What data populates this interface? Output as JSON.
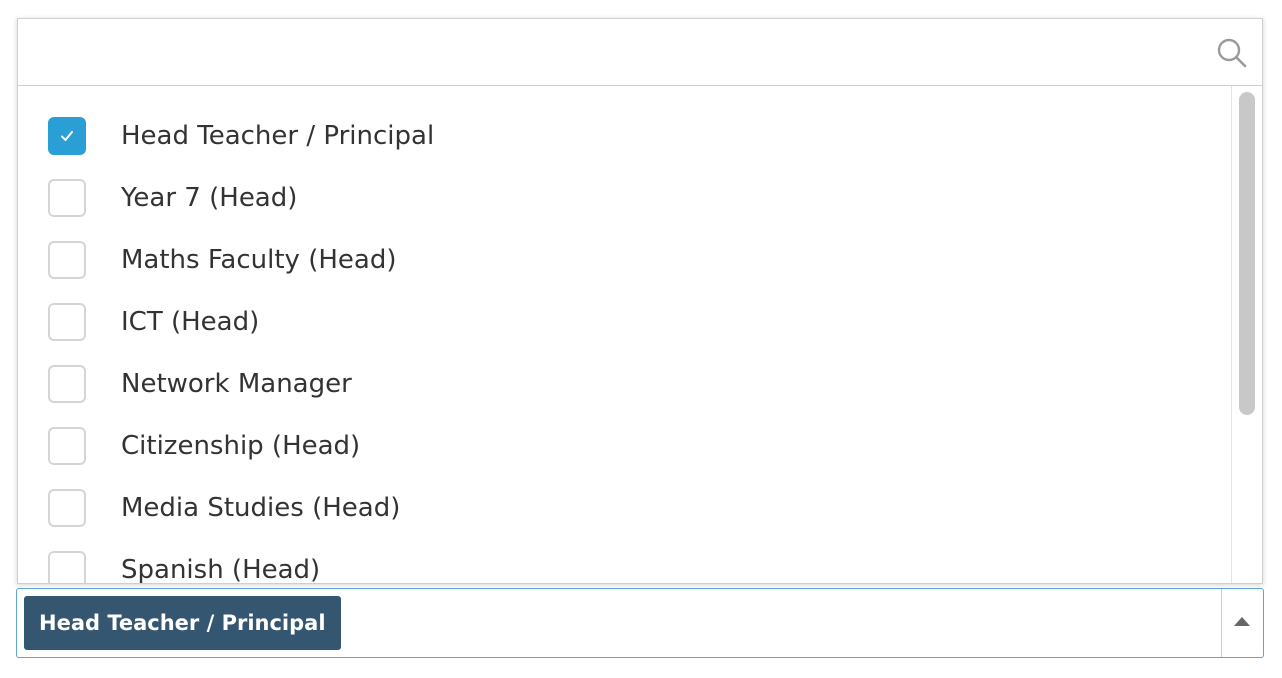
{
  "search": {
    "value": "",
    "placeholder": "",
    "icon": "search-icon"
  },
  "options": [
    {
      "label": "Head Teacher / Principal",
      "checked": true
    },
    {
      "label": "Year 7 (Head)",
      "checked": false
    },
    {
      "label": "Maths Faculty (Head)",
      "checked": false
    },
    {
      "label": "ICT (Head)",
      "checked": false
    },
    {
      "label": "Network Manager",
      "checked": false
    },
    {
      "label": "Citizenship (Head)",
      "checked": false
    },
    {
      "label": "Media Studies (Head)",
      "checked": false
    },
    {
      "label": "Spanish (Head)",
      "checked": false
    }
  ],
  "selected": {
    "tags": [
      "Head Teacher / Principal"
    ],
    "toggle_icon": "caret-up-icon"
  },
  "colors": {
    "accent": "#2a9fd6",
    "tag_background": "#345670",
    "focus_border": "#5ea4d6"
  }
}
